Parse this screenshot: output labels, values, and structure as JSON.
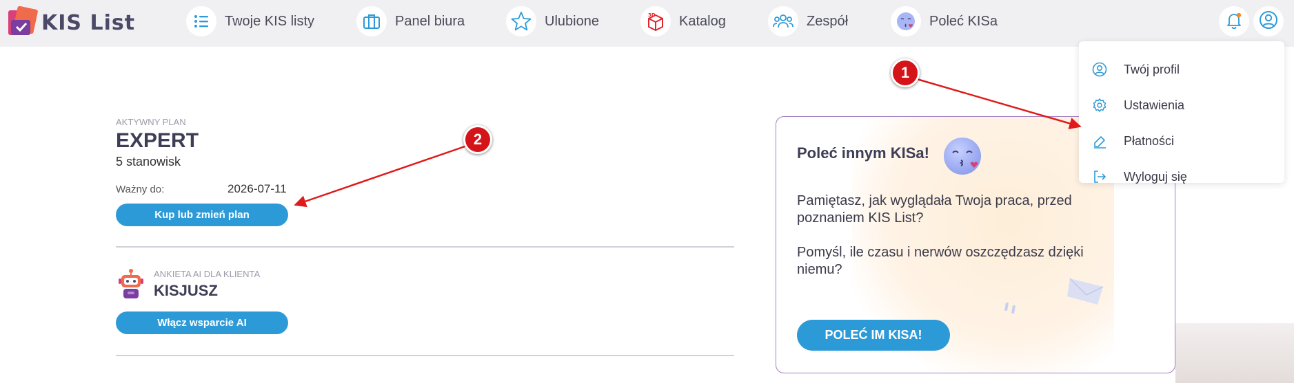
{
  "app": {
    "name": "KIS List"
  },
  "nav": {
    "items": [
      {
        "label": "Twoje KIS listy",
        "icon": "list-icon"
      },
      {
        "label": "Panel biura",
        "icon": "briefcase-icon"
      },
      {
        "label": "Ulubione",
        "icon": "star-icon"
      },
      {
        "label": "Katalog",
        "icon": "3d-box-icon"
      },
      {
        "label": "Zespół",
        "icon": "team-icon"
      },
      {
        "label": "Poleć KISa",
        "icon": "kiss-emoji-icon"
      }
    ]
  },
  "user_menu": {
    "items": [
      {
        "label": "Twój profil",
        "icon": "user-circle-icon"
      },
      {
        "label": "Ustawienia",
        "icon": "gear-icon"
      },
      {
        "label": "Płatności",
        "icon": "payment-icon"
      },
      {
        "label": "Wyloguj się",
        "icon": "logout-icon"
      }
    ]
  },
  "plan": {
    "caption": "AKTYWNY PLAN",
    "name": "EXPERT",
    "seats": "5 stanowisk",
    "valid_label": "Ważny do:",
    "valid_date": "2026-07-11",
    "button": "Kup lub zmień plan"
  },
  "ai": {
    "caption": "ANKIETA AI DLA KLIENTA",
    "name": "KISJUSZ",
    "button": "Włącz wsparcie AI"
  },
  "referral": {
    "title": "Poleć innym KISa!",
    "text1": "Pamiętasz, jak wyglądała Twoja praca, przed poznaniem KIS List?",
    "text2": "Pomyśl, ile czasu i nerwów oszczędzasz dzięki niemu?",
    "button": "POLEĆ IM KISA!"
  },
  "annotations": {
    "marker1": "1",
    "marker2": "2"
  },
  "colors": {
    "accent": "#2d9ad8",
    "marker": "#d41418",
    "card_border": "#a07cc0"
  }
}
